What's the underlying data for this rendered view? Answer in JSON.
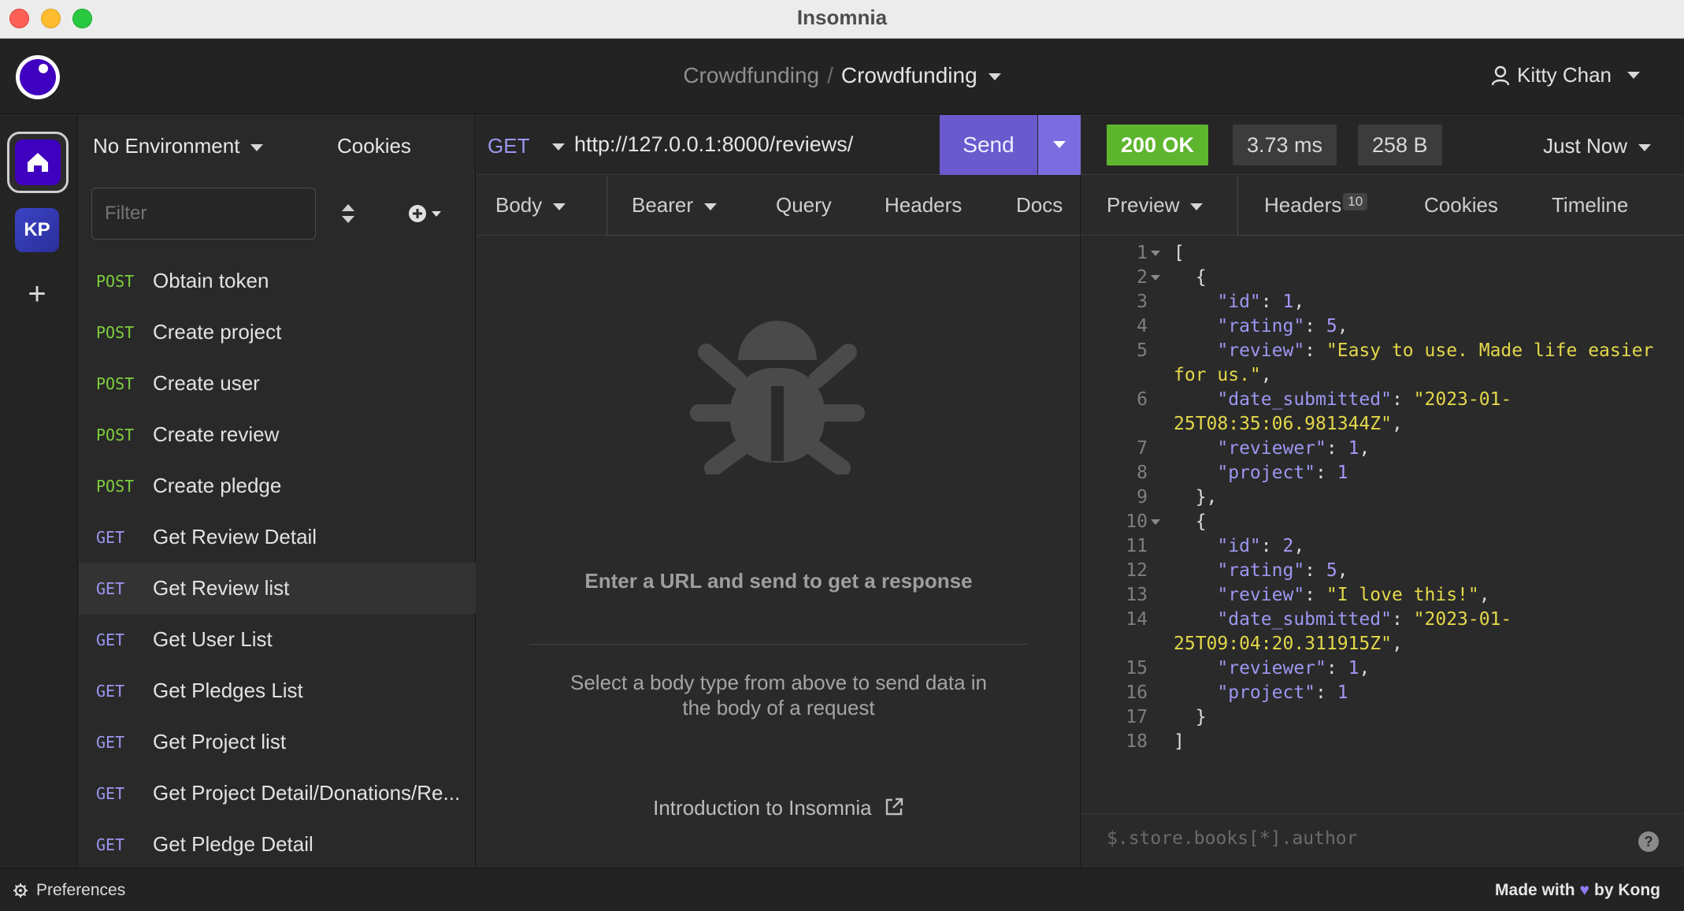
{
  "window": {
    "title": "Insomnia"
  },
  "header": {
    "breadcrumb_parent": "Crowdfunding",
    "breadcrumb_sep": "/",
    "breadcrumb_current": "Crowdfunding",
    "user": "Kitty Chan"
  },
  "rail": {
    "workspace_initials": "KP"
  },
  "sidebar": {
    "environment": "No Environment",
    "cookies": "Cookies",
    "filter_placeholder": "Filter",
    "requests": [
      {
        "method": "POST",
        "name": "Obtain token"
      },
      {
        "method": "POST",
        "name": "Create project"
      },
      {
        "method": "POST",
        "name": "Create user"
      },
      {
        "method": "POST",
        "name": "Create review"
      },
      {
        "method": "POST",
        "name": "Create pledge"
      },
      {
        "method": "GET",
        "name": "Get Review Detail"
      },
      {
        "method": "GET",
        "name": "Get Review list"
      },
      {
        "method": "GET",
        "name": "Get User List"
      },
      {
        "method": "GET",
        "name": "Get Pledges List"
      },
      {
        "method": "GET",
        "name": "Get Project list"
      },
      {
        "method": "GET",
        "name": "Get Project Detail/Donations/Re..."
      },
      {
        "method": "GET",
        "name": "Get Pledge Detail"
      }
    ]
  },
  "request": {
    "method": "GET",
    "url": "http://127.0.0.1:8000/reviews/",
    "send_label": "Send",
    "tabs": [
      "Body",
      "Bearer",
      "Query",
      "Headers",
      "Docs"
    ],
    "empty_title": "Enter a URL and send to get a response",
    "empty_sub": "Select a body type from above to send data in the body of a request",
    "intro_link": "Introduction to Insomnia"
  },
  "response": {
    "status": "200 OK",
    "time": "3.73 ms",
    "size": "258 B",
    "when": "Just Now",
    "tabs": [
      "Preview",
      "Headers",
      "Cookies",
      "Timeline"
    ],
    "headers_count": "10",
    "jq_placeholder": "$.store.books[*].author",
    "lines": [
      "1",
      "2",
      "3",
      "4",
      "5",
      "6",
      "7",
      "8",
      "9",
      "10",
      "11",
      "12",
      "13",
      "14",
      "15",
      "16",
      "17",
      "18"
    ]
  },
  "footer": {
    "preferences": "Preferences",
    "made_with": "Made with",
    "by": "by Kong"
  },
  "colors": {
    "accent": "#6a5acd",
    "post": "#7ece3f",
    "get": "#9c97f1",
    "ok": "#5eb52e"
  }
}
